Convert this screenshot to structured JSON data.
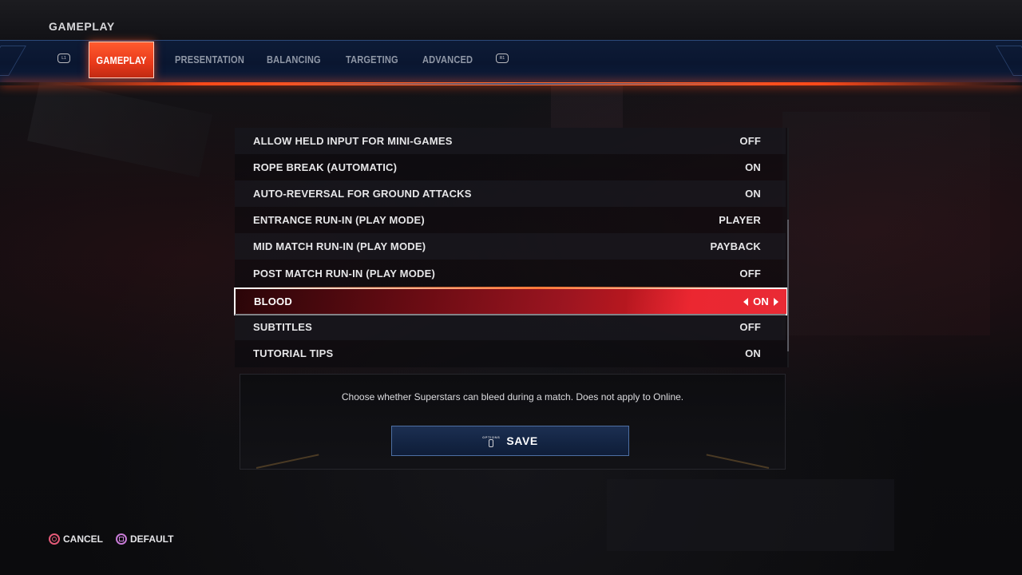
{
  "header": {
    "section_title": "GAMEPLAY"
  },
  "tabs": {
    "left_bumper": "L1",
    "right_bumper": "R1",
    "items": [
      {
        "label": "GAMEPLAY",
        "active": true
      },
      {
        "label": "PRESENTATION",
        "active": false
      },
      {
        "label": "BALANCING",
        "active": false
      },
      {
        "label": "TARGETING",
        "active": false
      },
      {
        "label": "ADVANCED",
        "active": false
      }
    ]
  },
  "settings": {
    "rows": [
      {
        "label": "ALLOW HELD INPUT FOR MINI-GAMES",
        "value": "OFF"
      },
      {
        "label": "ROPE BREAK (AUTOMATIC)",
        "value": "ON"
      },
      {
        "label": "AUTO-REVERSAL FOR GROUND ATTACKS",
        "value": "ON"
      },
      {
        "label": "ENTRANCE RUN-IN (PLAY MODE)",
        "value": "PLAYER"
      },
      {
        "label": "MID MATCH RUN-IN (PLAY MODE)",
        "value": "PAYBACK"
      },
      {
        "label": "POST MATCH RUN-IN (PLAY MODE)",
        "value": "OFF"
      },
      {
        "label": "BLOOD",
        "value": "ON",
        "selected": true
      },
      {
        "label": "SUBTITLES",
        "value": "OFF"
      },
      {
        "label": "TUTORIAL TIPS",
        "value": "ON"
      }
    ]
  },
  "description": {
    "text": "Choose whether Superstars can bleed during a match. Does not apply to Online."
  },
  "save": {
    "label": "SAVE",
    "icon_caption": "OPTIONS"
  },
  "footer": {
    "cancel_label": "CANCEL",
    "default_label": "DEFAULT"
  },
  "colors": {
    "accent_orange": "#ff4a1a",
    "selected_red": "#b5171f",
    "tabbar_blue": "#0a1630",
    "cancel_icon": "#e45a78",
    "default_icon": "#c77bd6"
  }
}
